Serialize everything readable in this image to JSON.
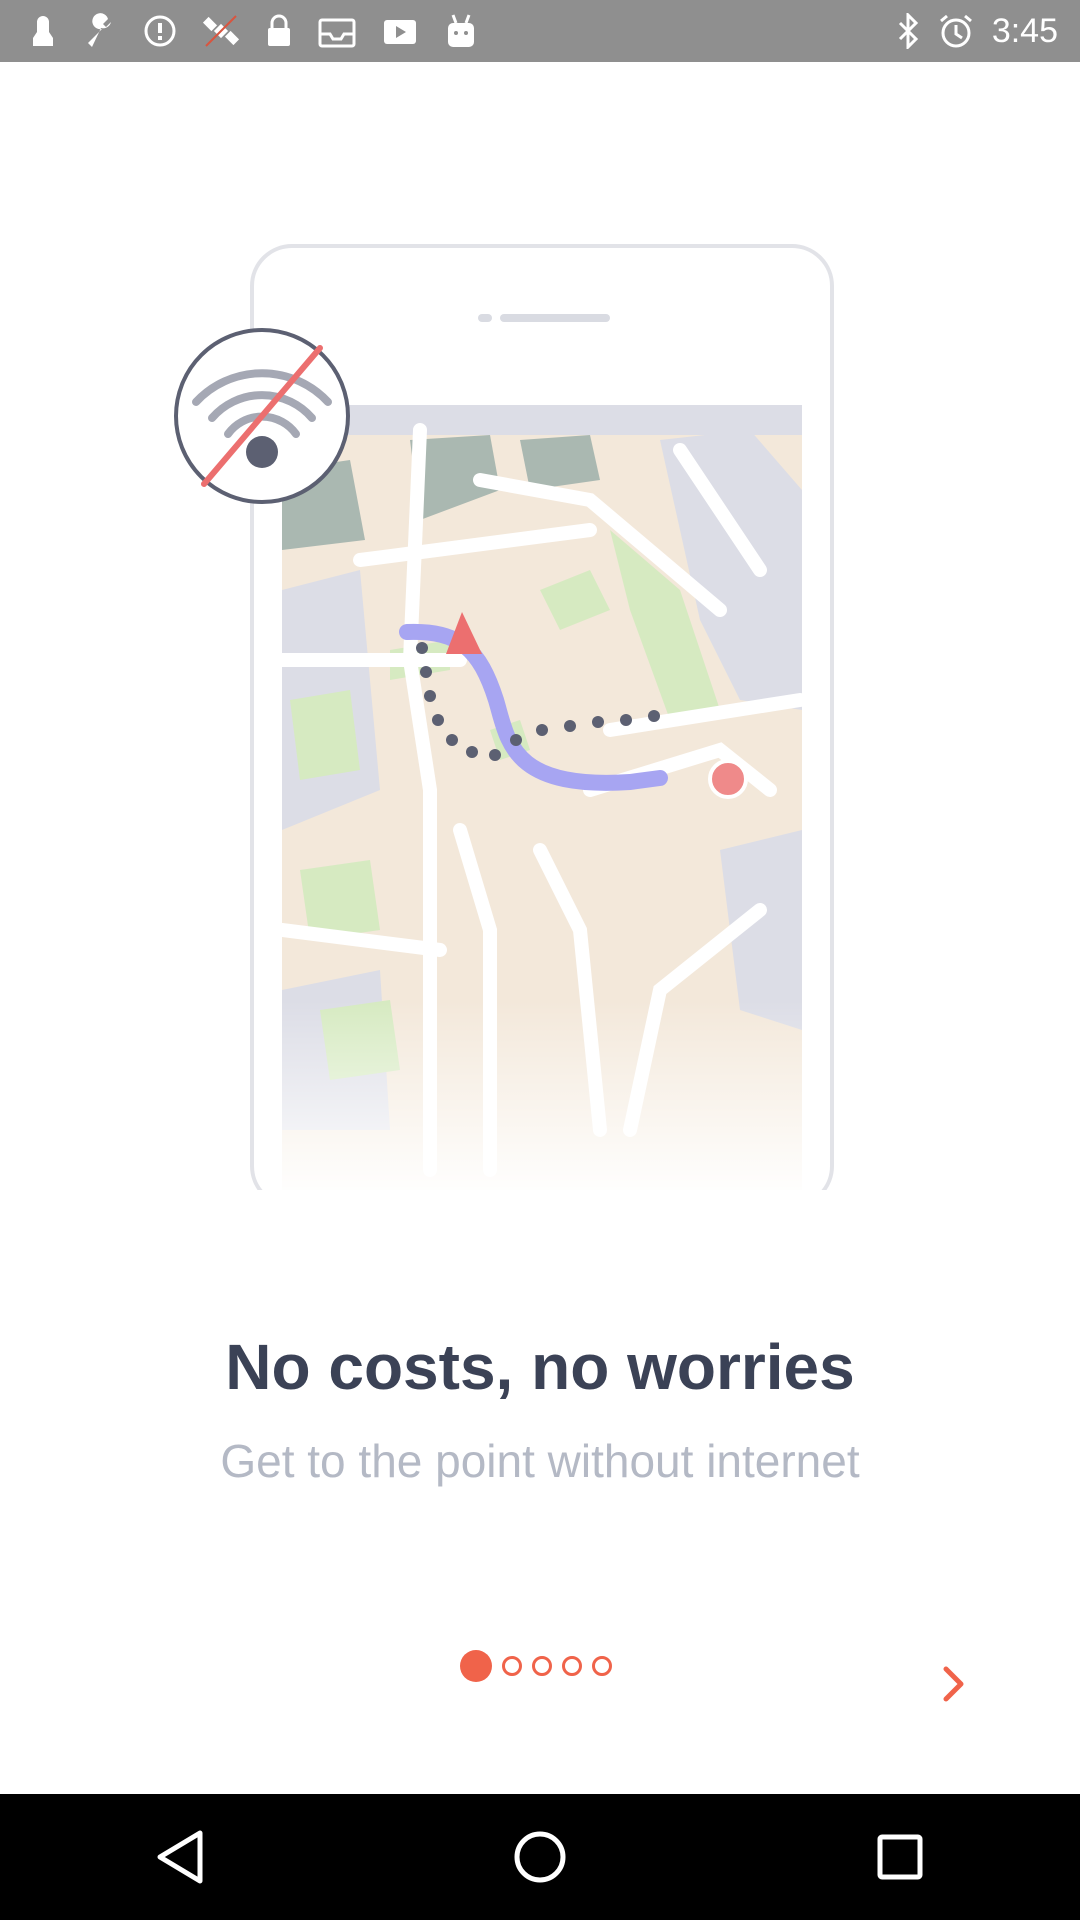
{
  "status_bar": {
    "time": "3:45",
    "left_icons": [
      "notification-icon",
      "wrench-icon",
      "info-icon",
      "satellite-icon",
      "lock-icon",
      "inbox-icon",
      "video-icon",
      "android-icon"
    ],
    "right_icons": [
      "bluetooth-icon",
      "alarm-icon"
    ]
  },
  "onboarding": {
    "headline": "No costs, no worries",
    "subline": "Get to the point without internet",
    "pages_total": 5,
    "current_page": 1
  },
  "colors": {
    "accent": "#f0634a",
    "headline": "#3b4256",
    "subline": "#b4b9c5",
    "route": "#a7a5f2"
  },
  "nav_bar": {
    "buttons": [
      "back-icon",
      "home-icon",
      "recents-icon"
    ]
  }
}
